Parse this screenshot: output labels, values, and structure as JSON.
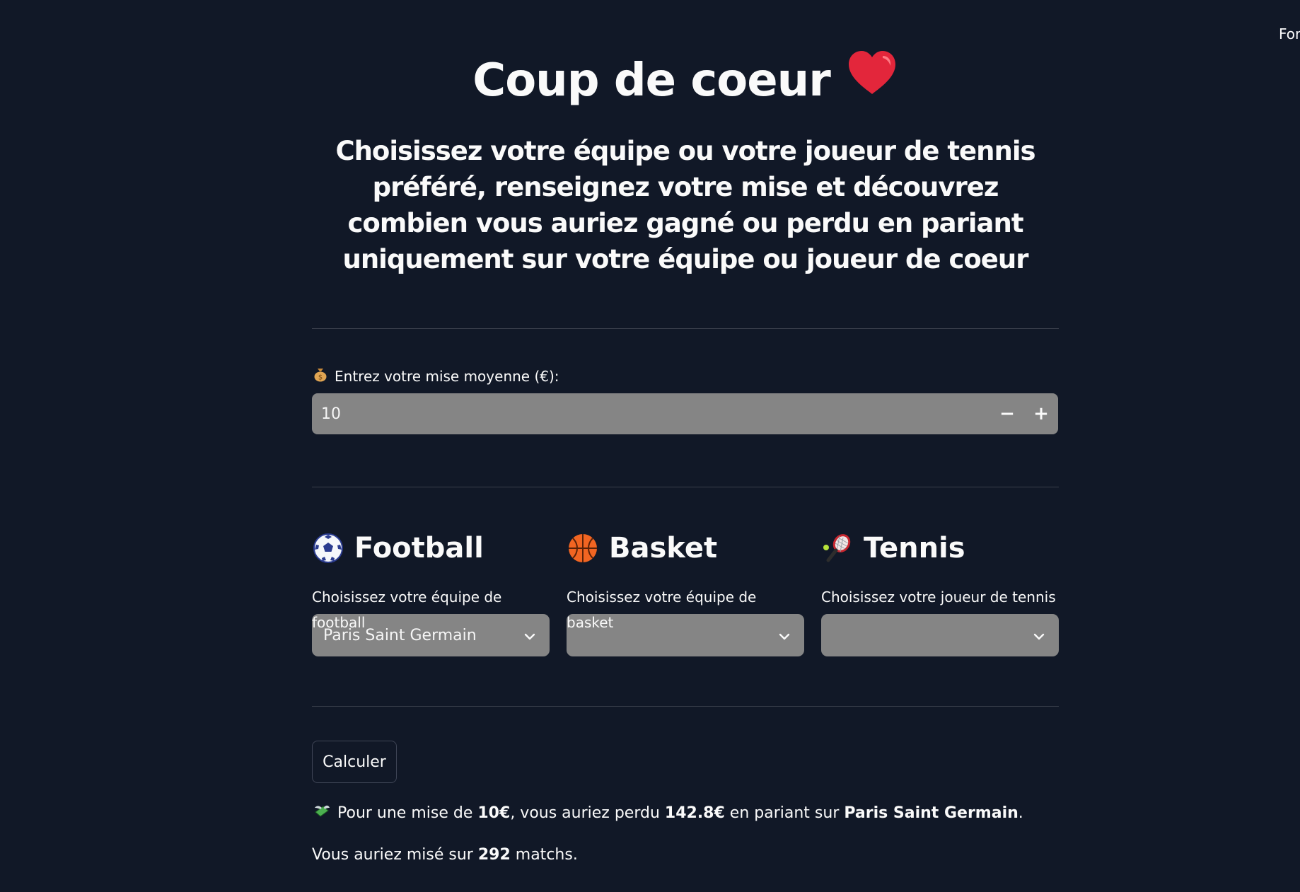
{
  "corner_text": "For",
  "header": {
    "title": "Coup de coeur",
    "subtitle": "Choisissez votre équipe ou votre joueur de tennis préféré, renseignez votre mise et découvrez combien vous auriez gagné ou perdu en pariant uniquement sur votre équipe ou joueur de coeur"
  },
  "stake": {
    "label": "Entrez votre mise moyenne (€):",
    "value": "10",
    "minus": "−",
    "plus": "+"
  },
  "sports": [
    {
      "title": "Football",
      "icon": "soccer-ball-icon",
      "label": "Choisissez votre équipe de football",
      "selected": "Paris Saint Germain"
    },
    {
      "title": "Basket",
      "icon": "basketball-icon",
      "label": "Choisissez votre équipe de basket",
      "selected": ""
    },
    {
      "title": "Tennis",
      "icon": "tennis-racket-icon",
      "label": "Choisissez votre joueur de tennis",
      "selected": ""
    }
  ],
  "calculate_label": "Calculer",
  "result": {
    "prefix": "Pour une mise de ",
    "stake": "10€",
    "middle": ", vous auriez perdu ",
    "amount": "142.8€",
    "middle2": " en pariant sur ",
    "team": "Paris Saint Germain",
    "suffix": "."
  },
  "matches": {
    "prefix": "Vous auriez misé sur ",
    "count": "292",
    "suffix": " matchs."
  },
  "colors": {
    "background": "#111827",
    "input_bg": "#858585",
    "heart": "#e3263b",
    "basketball": "#f26522"
  }
}
